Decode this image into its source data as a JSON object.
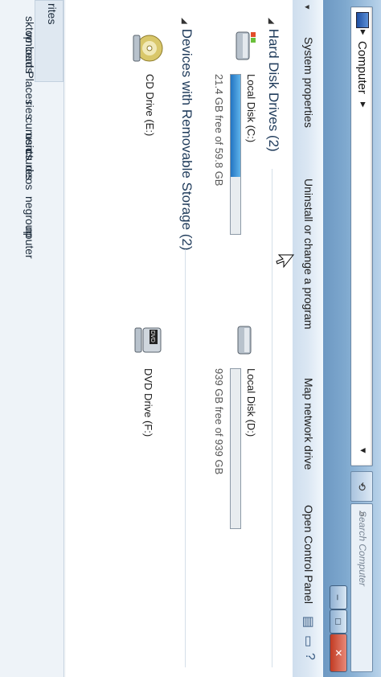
{
  "window": {
    "breadcrumb": "Computer",
    "search_placeholder": "Search Computer"
  },
  "toolbar": {
    "items": [
      "System properties",
      "Uninstall or change a program",
      "Map network drive",
      "Open Control Panel"
    ]
  },
  "navpane": {
    "items": [
      "rites",
      "sktop",
      "wnloads",
      "cent Places",
      "ries",
      "cuments",
      "usic",
      "ctures",
      "deos",
      "negroup",
      "nputer"
    ]
  },
  "groups": {
    "hard_disks": "Hard Disk Drives (2)",
    "removable": "Devices with Removable Storage (2)"
  },
  "drives": {
    "c": {
      "name": "Local Disk (C:)",
      "free": "21.4 GB free of 59.8 GB",
      "used_fraction": 0.64
    },
    "d": {
      "name": "Local Disk (D:)",
      "free": "939 GB free of 939 GB",
      "used_fraction": 0.0
    },
    "e": {
      "name": "CD Drive (E:)"
    },
    "f": {
      "name": "DVD Drive (F:)",
      "badge": "DVD"
    }
  },
  "colors": {
    "bar_fill": "#2274c2",
    "titlebar": "#7fa9cf"
  },
  "icons": {
    "computer": "computer-icon",
    "search": "search-icon",
    "hdd": "hard-disk-icon",
    "cd": "cd-drive-icon",
    "dvd": "dvd-drive-icon"
  }
}
